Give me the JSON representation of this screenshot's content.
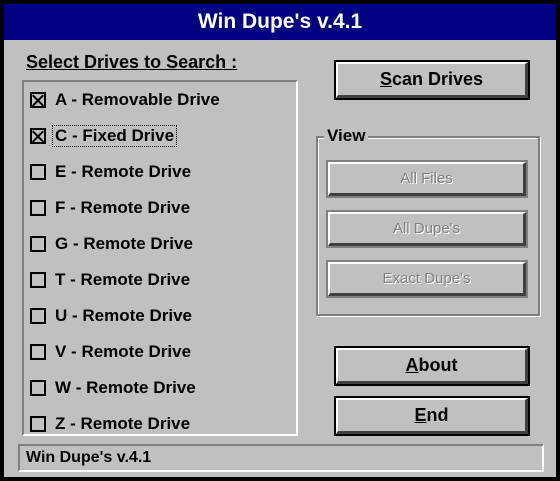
{
  "window": {
    "title": "Win Dupe's v.4.1"
  },
  "drives": {
    "section_label": "Select Drives to Search :",
    "items": [
      {
        "label": "A - Removable Drive",
        "checked": true
      },
      {
        "label": "C - Fixed Drive",
        "checked": true,
        "focused": true
      },
      {
        "label": "E - Remote Drive",
        "checked": false
      },
      {
        "label": "F - Remote Drive",
        "checked": false
      },
      {
        "label": "G - Remote Drive",
        "checked": false
      },
      {
        "label": "T - Remote Drive",
        "checked": false
      },
      {
        "label": "U - Remote Drive",
        "checked": false
      },
      {
        "label": "V - Remote Drive",
        "checked": false
      },
      {
        "label": "W - Remote Drive",
        "checked": false
      },
      {
        "label": "Z - Remote Drive",
        "checked": false
      }
    ]
  },
  "buttons": {
    "scan": {
      "mnemonic": "S",
      "rest": "can Drives"
    },
    "about": {
      "mnemonic": "A",
      "rest": "bout"
    },
    "end": {
      "mnemonic": "E",
      "rest": "nd"
    }
  },
  "view": {
    "legend": "View",
    "all_files": "All Files",
    "all_dupes": "All Dupe's",
    "exact_dupes": "Exact Dupe's"
  },
  "status": {
    "text": "Win Dupe's v.4.1"
  },
  "colors": {
    "title_bg": "#000080",
    "face": "#c0c0c0",
    "disabled_text": "#808080"
  }
}
